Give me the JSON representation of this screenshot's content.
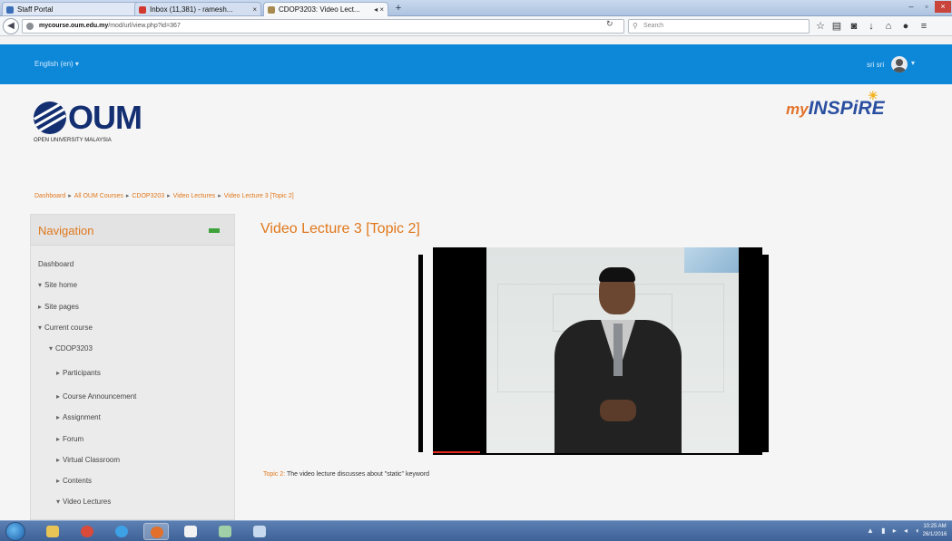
{
  "browser": {
    "tabs": [
      {
        "label": "Staff Portal"
      },
      {
        "label": "Inbox (11,381) - ramesh..."
      },
      {
        "label": "CDOP3203: Video Lect..."
      }
    ],
    "new_tab": "+",
    "url_host": "mycourse.oum.edu.my",
    "url_path": "/mod/url/view.php?id=367",
    "search_placeholder": "Search"
  },
  "site": {
    "language": "English (en) ▾",
    "user_label": "sri sri",
    "logo_text": "OUM",
    "logo_subtitle": "OPEN UNIVERSITY MALAYSIA",
    "brand_my": "my",
    "brand_inspire": "INSPiRE"
  },
  "breadcrumb": [
    "Dashboard",
    "All OUM Courses",
    "CDOP3203",
    "Video Lectures",
    "Video Lecture 3 [Topic 2]"
  ],
  "navigation": {
    "title": "Navigation",
    "items": [
      {
        "label": "Dashboard",
        "caret": ""
      },
      {
        "label": "Site home",
        "caret": "▾"
      },
      {
        "label": "Site pages",
        "caret": "▸"
      },
      {
        "label": "Current course",
        "caret": "▾"
      },
      {
        "label": "CDOP3203",
        "caret": "▾"
      },
      {
        "label": "Participants",
        "caret": "▸"
      },
      {
        "label": "Course Announcement",
        "caret": "▸"
      },
      {
        "label": "Assignment",
        "caret": "▸"
      },
      {
        "label": "Forum",
        "caret": "▸"
      },
      {
        "label": "Virtual Classroom",
        "caret": "▸"
      },
      {
        "label": "Contents",
        "caret": "▸"
      },
      {
        "label": "Video Lectures",
        "caret": "▾"
      }
    ]
  },
  "main": {
    "title": "Video Lecture 3 [Topic 2]",
    "caption_topic": "Topic 2:",
    "caption_text": "The video lecture discusses about \"static\" keyword"
  },
  "taskbar": {
    "time": "10:25 AM",
    "date": "26/1/2016"
  },
  "colors": {
    "accent": "#e0781c",
    "site_bar": "#0d87d8",
    "brand_navy": "#132f72"
  }
}
